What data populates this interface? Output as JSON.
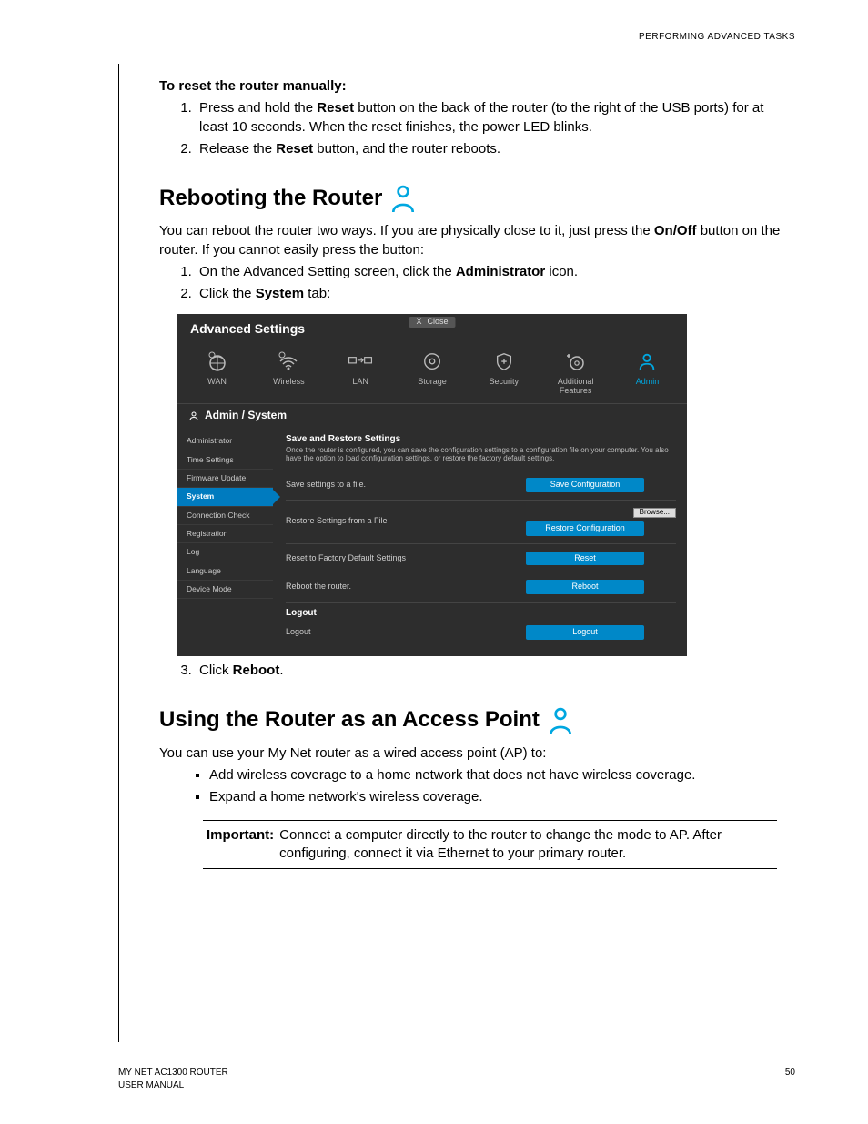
{
  "header": "PERFORMING ADVANCED TASKS",
  "manual_reset_heading": "To reset the router manually:",
  "manual_reset_steps": {
    "s1a": "Press and hold the ",
    "s1b": "Reset",
    "s1c": " button on the back of the router (to the right of the USB ports) for at least 10 seconds. When the reset finishes, the power LED blinks.",
    "s2a": "Release the ",
    "s2b": "Reset",
    "s2c": " button, and the router reboots."
  },
  "rebooting_heading": "Rebooting the Router",
  "rebooting_intro_a": "You can reboot the router two ways. If you are physically close to it, just press the ",
  "rebooting_intro_b": "On/Off",
  "rebooting_intro_c": " button on the router. If you cannot easily press the button:",
  "rebooting_steps": {
    "s1a": "On the Advanced Setting screen, click the ",
    "s1b": "Administrator",
    "s1c": " icon.",
    "s2a": "Click the ",
    "s2b": "System",
    "s2c": " tab:",
    "s3a": "Click ",
    "s3b": "Reboot",
    "s3c": "."
  },
  "ap_heading": "Using the Router as an Access Point",
  "ap_intro": "You can use your My Net router as a wired access point (AP) to:",
  "ap_bullets": {
    "b1": "Add wireless coverage to a home network that does not have wireless coverage.",
    "b2": "Expand a home network's wireless coverage."
  },
  "note_label": "Important:",
  "note_text": "Connect a computer directly to the router to change the mode to AP. After configuring, connect it via Ethernet to your primary router.",
  "footer_left_a": "MY NET AC1300 ROUTER",
  "footer_left_b": "USER MANUAL",
  "footer_page": "50",
  "router": {
    "title": "Advanced Settings",
    "close_x": "X",
    "close": "Close",
    "nav": {
      "wan": "WAN",
      "wireless": "Wireless",
      "lan": "LAN",
      "storage": "Storage",
      "security": "Security",
      "additional": "Additional Features",
      "admin": "Admin"
    },
    "breadcrumb": "Admin / System",
    "side": {
      "administrator": "Administrator",
      "time": "Time Settings",
      "firmware": "Firmware Update",
      "system": "System",
      "conn": "Connection Check",
      "reg": "Registration",
      "log": "Log",
      "lang": "Language",
      "mode": "Device Mode"
    },
    "main": {
      "save_title": "Save and Restore Settings",
      "save_desc": "Once the router is configured, you can save the configuration settings to a configuration file on your computer. You also have the option to load configuration settings, or restore the factory default settings.",
      "row_save_label": "Save settings to a file.",
      "btn_save": "Save Configuration",
      "row_restore_label": "Restore Settings from a File",
      "btn_browse": "Browse...",
      "btn_restore": "Restore Configuration",
      "row_reset_label": "Reset to Factory Default Settings",
      "btn_reset": "Reset",
      "row_reboot_label": "Reboot the router.",
      "btn_reboot": "Reboot",
      "logout_title": "Logout",
      "row_logout_label": "Logout",
      "btn_logout": "Logout"
    }
  }
}
